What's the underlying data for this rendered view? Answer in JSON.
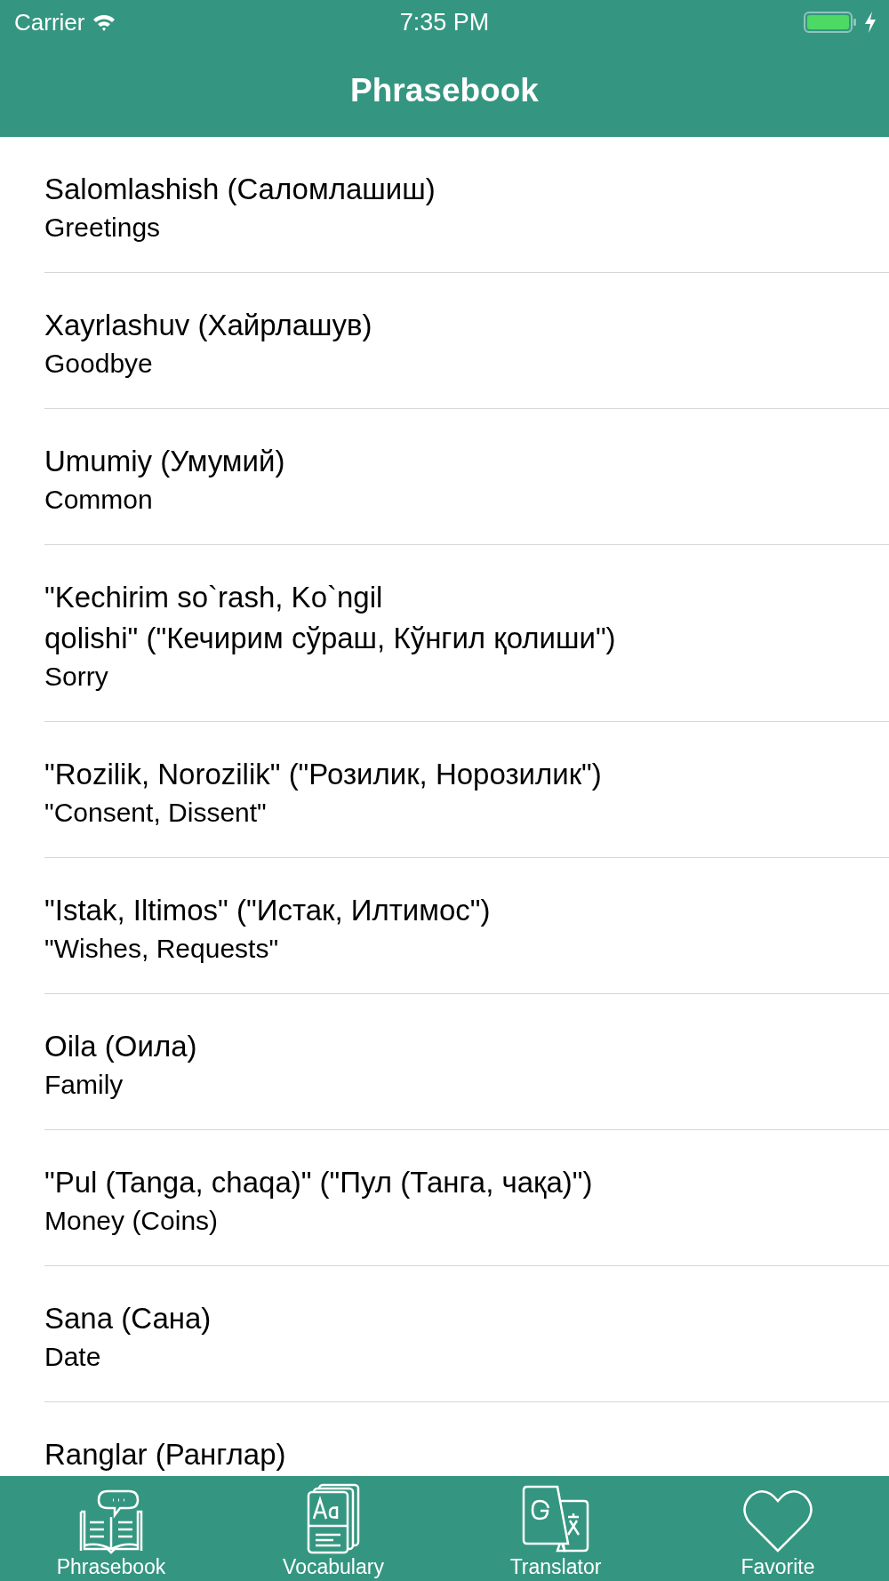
{
  "status_bar": {
    "carrier": "Carrier",
    "time": "7:35 PM"
  },
  "nav_bar": {
    "title": "Phrasebook"
  },
  "topics": [
    {
      "title": "Salomlashish (Саломлашиш)",
      "subtitle": "Greetings"
    },
    {
      "title": "Xayrlashuv (Хайрлашув)",
      "subtitle": "Goodbye"
    },
    {
      "title": "Umumiy (Умумий)",
      "subtitle": "Common"
    },
    {
      "title": "\"Kechirim so`rash, Ko`ngil\nqolishi\" (\"Кечирим сўраш, Кўнгил қолиши\")",
      "subtitle": "Sorry"
    },
    {
      "title": "\"Rozilik, Norozilik\" (\"Розилик, Норозилик\")",
      "subtitle": "\"Consent, Dissent\""
    },
    {
      "title": "\"Istak, Iltimos\" (\"Истак, Илтимос\")",
      "subtitle": "\"Wishes, Requests\""
    },
    {
      "title": "Oila (Оила)",
      "subtitle": "Family"
    },
    {
      "title": "\"Pul (Tanga, chaqa)\" (\"Пул (Танга, чақа)\")",
      "subtitle": "Money (Coins)"
    },
    {
      "title": "Sana (Сана)",
      "subtitle": "Date"
    },
    {
      "title": "Ranglar (Ранглар)"
    }
  ],
  "tab_bar": [
    {
      "kind": "phrasebook",
      "label": "Phrasebook"
    },
    {
      "kind": "vocabulary",
      "label": "Vocabulary"
    },
    {
      "kind": "translator",
      "label": "Translator"
    },
    {
      "kind": "favorite",
      "label": "Favorite"
    }
  ]
}
